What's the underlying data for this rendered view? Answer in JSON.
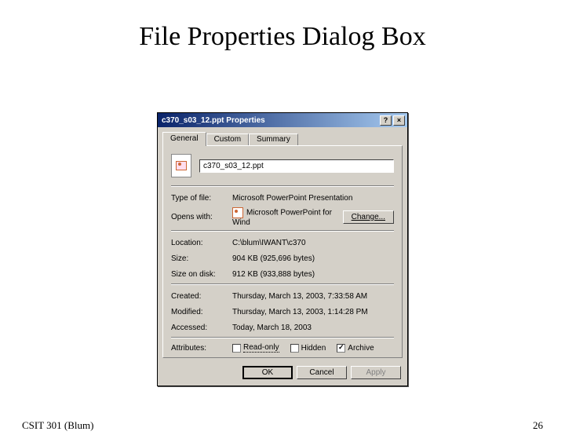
{
  "slide": {
    "title": "File Properties Dialog Box",
    "footer_left": "CSIT 301 (Blum)",
    "footer_right": "26"
  },
  "dialog": {
    "title": "c370_s03_12.ppt Properties",
    "help_glyph": "?",
    "close_glyph": "×",
    "tabs": {
      "general": "General",
      "custom": "Custom",
      "summary": "Summary"
    },
    "filename": "c370_s03_12.ppt",
    "rows": {
      "type_label": "Type of file:",
      "type_value": "Microsoft PowerPoint Presentation",
      "opens_label": "Opens with:",
      "opens_value": "Microsoft PowerPoint for Wind",
      "change_label": "Change...",
      "location_label": "Location:",
      "location_value": "C:\\blum\\IWANT\\c370",
      "size_label": "Size:",
      "size_value": "904 KB (925,696 bytes)",
      "sizeondisk_label": "Size on disk:",
      "sizeondisk_value": "912 KB (933,888 bytes)",
      "created_label": "Created:",
      "created_value": "Thursday, March 13, 2003, 7:33:58 AM",
      "modified_label": "Modified:",
      "modified_value": "Thursday, March 13, 2003, 1:14:28 PM",
      "accessed_label": "Accessed:",
      "accessed_value": "Today, March 18, 2003"
    },
    "attributes": {
      "label": "Attributes:",
      "readonly": "Read-only",
      "hidden": "Hidden",
      "archive": "Archive"
    },
    "buttons": {
      "ok": "OK",
      "cancel": "Cancel",
      "apply": "Apply"
    }
  }
}
